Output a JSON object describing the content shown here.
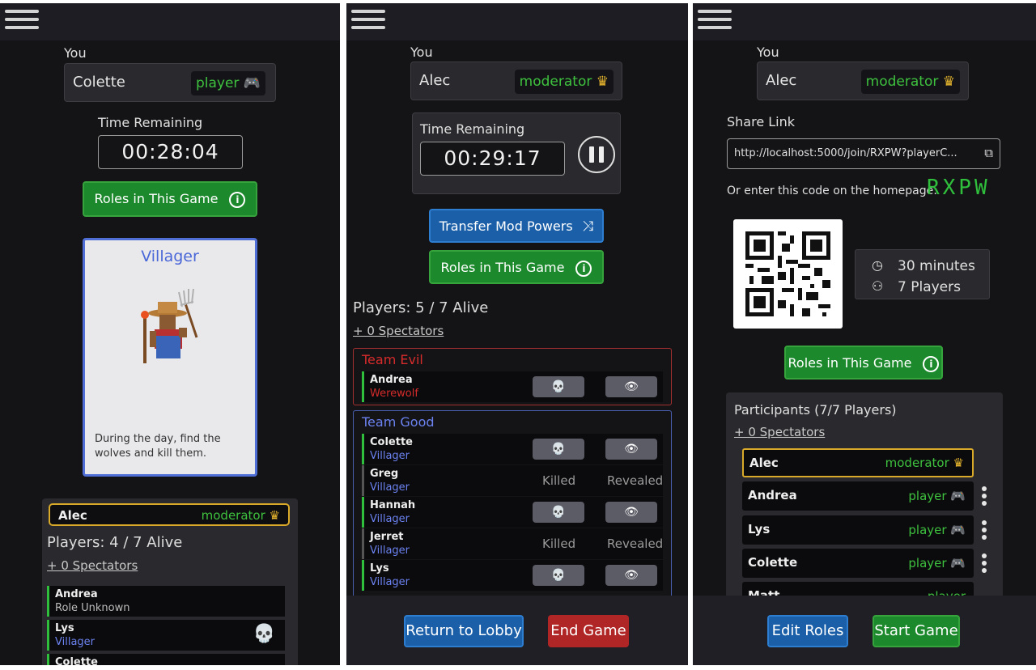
{
  "panel1": {
    "you_label": "You",
    "name": "Colette",
    "role": "player",
    "role_icon": "gamepad-icon",
    "time_label": "Time Remaining",
    "time": "00:28:04",
    "roles_button": "Roles in This Game",
    "card": {
      "title": "Villager",
      "description": "During the day, find the wolves and kill them."
    },
    "mod_name": "Alec",
    "mod_role": "moderator",
    "players_alive": "Players: 4 / 7 Alive",
    "spectators": "+ 0 Spectators",
    "players": [
      {
        "name": "Andrea",
        "role": "Role Unknown"
      },
      {
        "name": "Lys",
        "role": "Villager"
      },
      {
        "name": "Colette",
        "role": ""
      }
    ]
  },
  "panel2": {
    "you_label": "You",
    "name": "Alec",
    "role": "moderator",
    "time_label": "Time Remaining",
    "time": "00:29:17",
    "transfer_button": "Transfer Mod Powers",
    "roles_button": "Roles in This Game",
    "players_alive": "Players: 5 / 7 Alive",
    "spectators": "+ 0 Spectators",
    "team_evil": {
      "label": "Team Evil",
      "players": [
        {
          "name": "Andrea",
          "role": "Werewolf"
        }
      ]
    },
    "team_good": {
      "label": "Team Good",
      "players": [
        {
          "name": "Colette",
          "role": "Villager",
          "state": "alive"
        },
        {
          "name": "Greg",
          "role": "Villager",
          "state": "killed",
          "killed": "Killed",
          "revealed": "Revealed"
        },
        {
          "name": "Hannah",
          "role": "Villager",
          "state": "alive"
        },
        {
          "name": "Jerret",
          "role": "Villager",
          "state": "killed",
          "killed": "Killed",
          "revealed": "Revealed"
        },
        {
          "name": "Lys",
          "role": "Villager",
          "state": "alive"
        }
      ]
    },
    "return_button": "Return to Lobby",
    "end_button": "End Game"
  },
  "panel3": {
    "you_label": "You",
    "name": "Alec",
    "role": "moderator",
    "share_label": "Share Link",
    "share_url": "http://localhost:5000/join/RXPW?playerC...",
    "code_prompt": "Or enter this code on the homepage:",
    "code": "RXPW",
    "duration": "30 minutes",
    "player_count": "7 Players",
    "roles_button": "Roles in This Game",
    "participants_label": "Participants (7/7 Players)",
    "spectators": "+ 0 Spectators",
    "participants": [
      {
        "name": "Alec",
        "role": "moderator"
      },
      {
        "name": "Andrea",
        "role": "player"
      },
      {
        "name": "Lys",
        "role": "player"
      },
      {
        "name": "Colette",
        "role": "player"
      },
      {
        "name": "Matt",
        "role": "player"
      }
    ],
    "edit_button": "Edit Roles",
    "start_button": "Start Game"
  },
  "colors": {
    "background": "#141416",
    "accent_green": "#3ec13e",
    "team_evil": "#d62b2b",
    "team_good": "#6b82f0",
    "crown": "#e8b62e"
  }
}
